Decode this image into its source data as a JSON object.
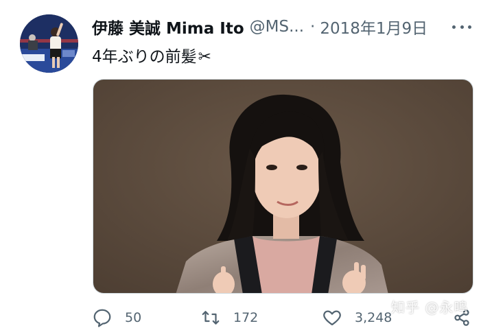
{
  "author": {
    "display_name": "伊藤 美誠 Mima Ito",
    "handle": "@MS...",
    "separator": "·",
    "date": "2018年1月9日",
    "avatar_icon": "profile-photo"
  },
  "tweet": {
    "text": "4年ぶりの前髪",
    "emoji": "✂",
    "media_description": "photo"
  },
  "actions": {
    "reply_count": "50",
    "retweet_count": "172",
    "like_count": "3,248"
  },
  "icons": {
    "more": "more-dots-icon",
    "reply": "reply-icon",
    "retweet": "retweet-icon",
    "like": "heart-icon",
    "share": "share-icon"
  },
  "watermark": "知乎 @永鸣",
  "colors": {
    "text_primary": "#0f1419",
    "text_secondary": "#536471",
    "media_border": "#cfd9de"
  }
}
